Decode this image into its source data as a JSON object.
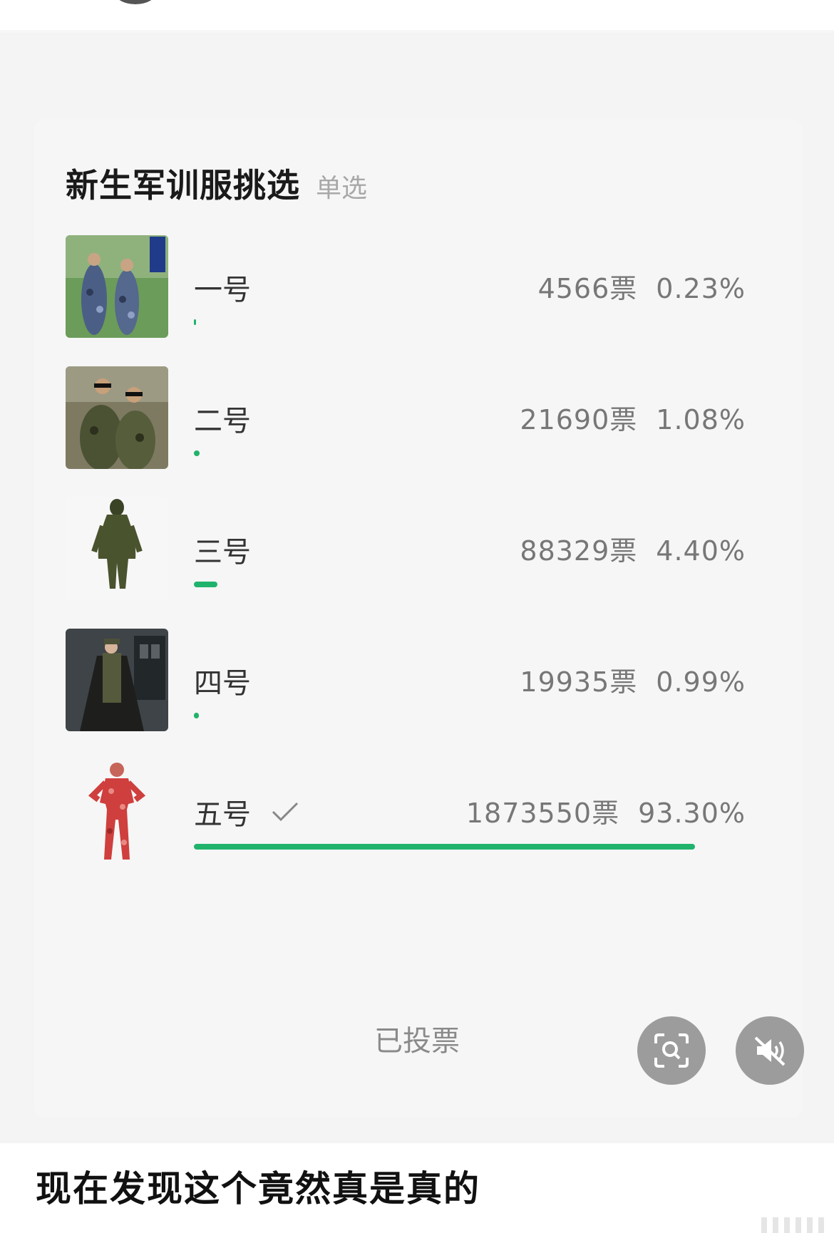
{
  "poll": {
    "title": "新生军训服挑选",
    "type_label": "单选",
    "options": [
      {
        "label": "一号",
        "votes": "4566票",
        "percent": "0.23%",
        "fraction": 0.0023,
        "checked": false
      },
      {
        "label": "二号",
        "votes": "21690票",
        "percent": "1.08%",
        "fraction": 0.0108,
        "checked": false
      },
      {
        "label": "三号",
        "votes": "88329票",
        "percent": "4.40%",
        "fraction": 0.044,
        "checked": false
      },
      {
        "label": "四号",
        "votes": "19935票",
        "percent": "0.99%",
        "fraction": 0.0099,
        "checked": false
      },
      {
        "label": "五号",
        "votes": "1873550票",
        "percent": "93.30%",
        "fraction": 0.933,
        "checked": true
      }
    ],
    "voted_label": "已投票"
  },
  "controls": {
    "scan_icon": "scan-search-icon",
    "mute_icon": "speaker-muted-icon"
  },
  "caption": "现在发现这个竟然真是真的",
  "colors": {
    "accent": "#20b36b",
    "fab": "#9c9c9c"
  }
}
